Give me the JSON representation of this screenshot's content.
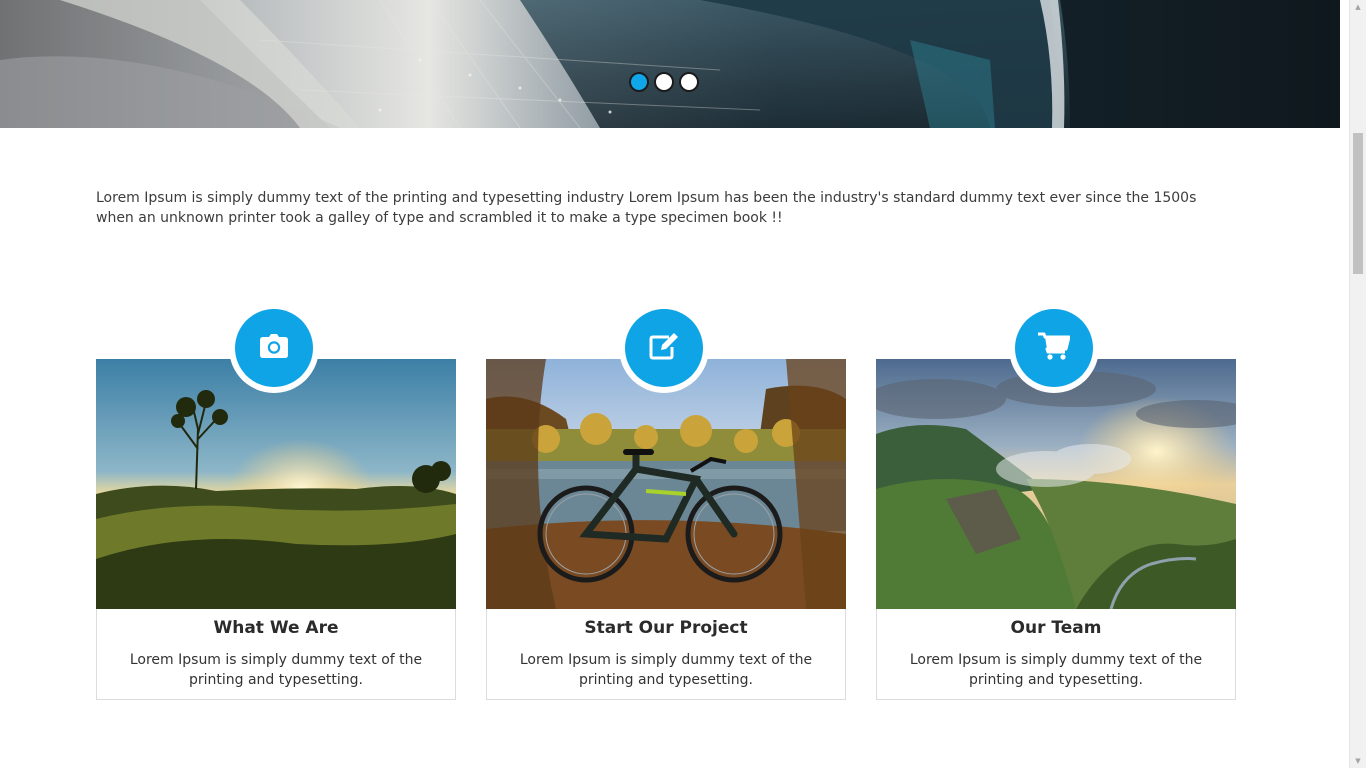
{
  "hero": {
    "slides": [
      {
        "label": "Slide 1",
        "active": true
      },
      {
        "label": "Slide 2",
        "active": false
      },
      {
        "label": "Slide 3",
        "active": false
      }
    ]
  },
  "intro": {
    "text": "Lorem Ipsum is simply dummy text of the printing and typesetting industry Lorem Ipsum has been the industry's standard dummy text ever since the 1500s when an unknown printer took a galley of type and scrambled it to make a type specimen book !!"
  },
  "cards": [
    {
      "icon": "camera-icon",
      "title": "What We Are",
      "text": "Lorem Ipsum is simply dummy text of the printing and typesetting."
    },
    {
      "icon": "edit-icon",
      "title": "Start Our Project",
      "text": "Lorem Ipsum is simply dummy text of the printing and typesetting."
    },
    {
      "icon": "shopping-cart-icon",
      "title": "Our Team",
      "text": "Lorem Ipsum is simply dummy text of the printing and typesetting."
    }
  ],
  "colors": {
    "accent": "#0ea4e6",
    "dot_active": "#10a6ea",
    "card_border": "#dcdcdc"
  }
}
